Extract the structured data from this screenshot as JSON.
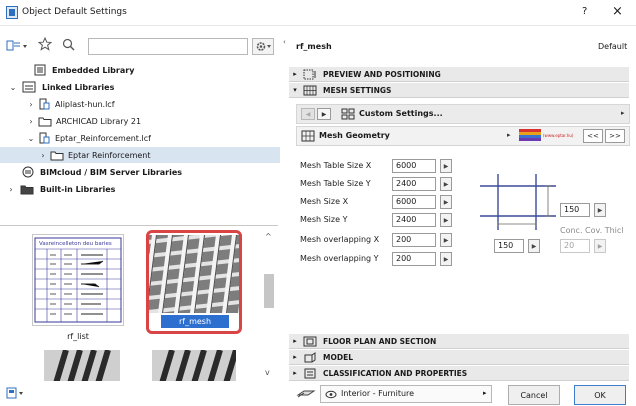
{
  "window": {
    "title": "Object Default Settings",
    "help": "?",
    "close": "×"
  },
  "tree": {
    "items": [
      {
        "label": "Embedded Library",
        "bold": true
      },
      {
        "label": "Linked Libraries",
        "bold": true
      },
      {
        "label": "Aliplast-hun.lcf",
        "bold": false
      },
      {
        "label": "ARCHICAD Library 21",
        "bold": false
      },
      {
        "label": "Eptar_Reinforcement.lcf",
        "bold": false
      },
      {
        "label": "Eptar Reinforcement",
        "bold": false
      },
      {
        "label": "BIMcloud / BIM Server Libraries",
        "bold": true
      },
      {
        "label": "Built-in Libraries",
        "bold": true
      }
    ]
  },
  "thumbnails": {
    "items": [
      {
        "label": "rf_list",
        "selected": false,
        "table_heading": "Vasreincelleton deu baries"
      },
      {
        "label": "rf_mesh",
        "selected": true
      }
    ]
  },
  "right": {
    "object_name": "rf_mesh",
    "default_label": "Default",
    "sections_top": [
      {
        "label": "PREVIEW AND POSITIONING",
        "expanded": false
      },
      {
        "label": "MESH SETTINGS",
        "expanded": true
      }
    ],
    "custom_settings": "Custom Settings...",
    "mesh_geometry": "Mesh Geometry",
    "brand_label": "(www.eptar.hu)",
    "nav_prev": "<<",
    "nav_next": ">>",
    "fields": [
      {
        "label": "Mesh Table Size X",
        "value": "6000"
      },
      {
        "label": "Mesh Table Size Y",
        "value": "2400"
      },
      {
        "label": "Mesh Size X",
        "value": "6000"
      },
      {
        "label": "Mesh Size Y",
        "value": "2400"
      },
      {
        "label": "Mesh overlapping X",
        "value": "200"
      },
      {
        "label": "Mesh overlapping Y",
        "value": "200"
      }
    ],
    "diagram": {
      "spacing_y": "150",
      "spacing_x": "150",
      "conc_cov_label": "Conc. Cov. Thicl",
      "conc_cov_value": "20"
    },
    "sections_bottom": [
      {
        "label": "FLOOR PLAN AND SECTION"
      },
      {
        "label": "MODEL"
      },
      {
        "label": "CLASSIFICATION AND PROPERTIES"
      }
    ],
    "layer": "Interior - Furniture",
    "cancel": "Cancel",
    "ok": "OK"
  }
}
